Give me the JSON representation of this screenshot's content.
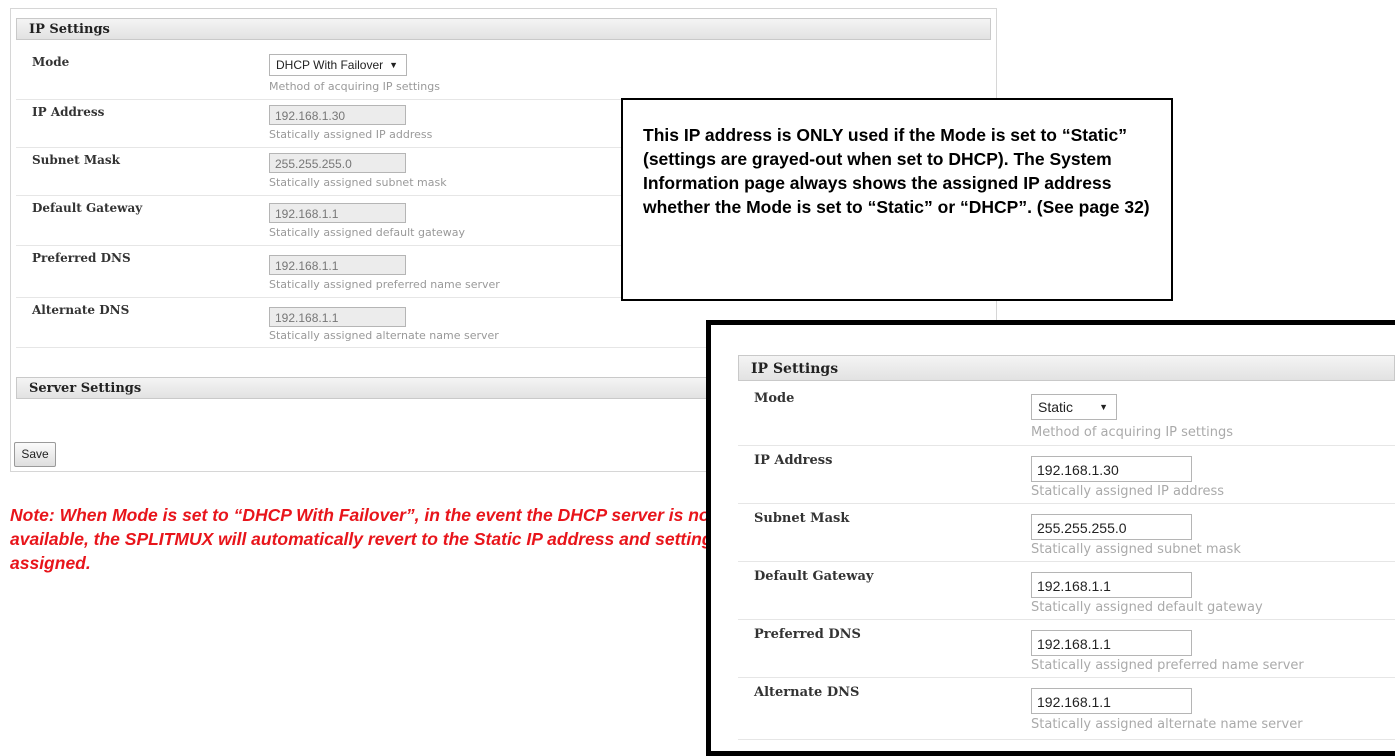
{
  "left_panel": {
    "header": "IP Settings",
    "mode": {
      "label": "Mode",
      "value": "DHCP With Failover",
      "hint": "Method of acquiring IP settings"
    },
    "ip": {
      "label": "IP Address",
      "value": "192.168.1.30",
      "hint": "Statically assigned IP address"
    },
    "subnet": {
      "label": "Subnet Mask",
      "value": "255.255.255.0",
      "hint": "Statically assigned subnet mask"
    },
    "gateway": {
      "label": "Default Gateway",
      "value": "192.168.1.1",
      "hint": "Statically assigned default gateway"
    },
    "pdns": {
      "label": "Preferred DNS",
      "value": "192.168.1.1",
      "hint": "Statically assigned preferred name server"
    },
    "adns": {
      "label": "Alternate DNS",
      "value": "192.168.1.1",
      "hint": "Statically assigned alternate name server"
    },
    "server_header": "Server Settings",
    "save_label": "Save"
  },
  "callout": {
    "text": "This IP address is ONLY used if the Mode is set to “Static” (settings are grayed-out when set to DHCP).   The System Information page always shows the assigned IP address whether the Mode is set to “Static” or “DHCP”.   (See page 32)"
  },
  "note": {
    "text": "Note:   When Mode is set to “DHCP With Failover”, in the event the DHCP server is not available, the SPLITMUX will automatically revert to the Static IP address and settings assigned."
  },
  "right_panel": {
    "header": "IP Settings",
    "mode": {
      "label": "Mode",
      "value": "Static",
      "hint": "Method of acquiring IP settings"
    },
    "ip": {
      "label": "IP Address",
      "value": "192.168.1.30",
      "hint": "Statically assigned IP address"
    },
    "subnet": {
      "label": "Subnet Mask",
      "value": "255.255.255.0",
      "hint": "Statically assigned subnet mask"
    },
    "gateway": {
      "label": "Default Gateway",
      "value": "192.168.1.1",
      "hint": "Statically assigned default gateway"
    },
    "pdns": {
      "label": "Preferred DNS",
      "value": "192.168.1.1",
      "hint": "Statically assigned preferred name server"
    },
    "adns": {
      "label": "Alternate DNS",
      "value": "192.168.1.1",
      "hint": "Statically assigned alternate name server"
    }
  },
  "icons": {
    "dropdown": "caret-down-icon"
  }
}
